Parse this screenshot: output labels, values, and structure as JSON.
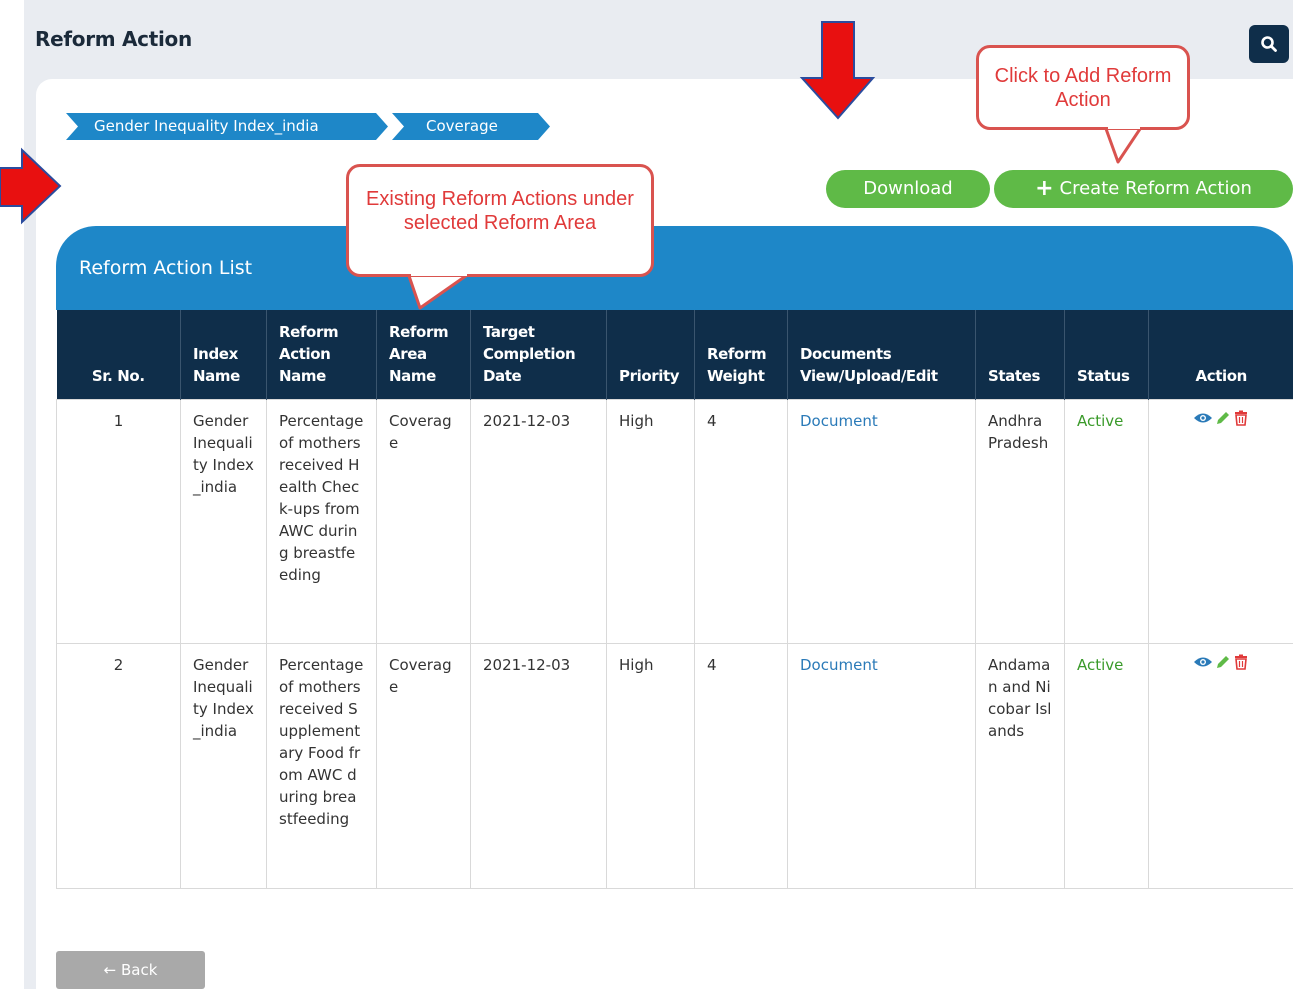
{
  "page": {
    "title": "Reform Action"
  },
  "breadcrumb": [
    {
      "label": "Gender Inequality Index_india"
    },
    {
      "label": "Coverage"
    }
  ],
  "buttons": {
    "download": "Download",
    "create": "Create Reform Action",
    "back": "Back"
  },
  "list": {
    "title": "Reform Action List",
    "columns": [
      "Sr. No.",
      "Index Name",
      "Reform Action Name",
      "Reform Area Name",
      "Target Completion Date",
      "Priority",
      "Reform Weight",
      "Documents View/Upload/Edit",
      "States",
      "Status",
      "Action"
    ],
    "rows": [
      {
        "sr": "1",
        "index_name": "Gender Inequality Index_india",
        "action_name": "Percentage of mothers received Health Check-ups from AWC during breastfeeding",
        "area_name": "Coverage",
        "target_date": "2021-12-03",
        "priority": "High",
        "weight": "4",
        "document": "Document",
        "states": "Andhra Pradesh",
        "status": "Active"
      },
      {
        "sr": "2",
        "index_name": "Gender Inequality Index_india",
        "action_name": "Percentage of mothers received Supplementary Food from AWC during breastfeeding",
        "area_name": "Coverage",
        "target_date": "2021-12-03",
        "priority": "High",
        "weight": "4",
        "document": "Document",
        "states": "Andaman and Nicobar Islands",
        "status": "Active"
      }
    ]
  },
  "annotations": {
    "callout_add": "Click to Add Reform Action",
    "callout_existing": "Existing Reform Actions under selected Reform Area"
  },
  "icons": {
    "search": "search-icon",
    "plus": "plus-icon",
    "back": "arrow-left-icon",
    "view": "eye-icon",
    "edit": "pencil-icon",
    "delete": "trash-icon"
  },
  "colors": {
    "navy": "#0f2e4a",
    "blue": "#1e87c8",
    "green": "#5fba47",
    "annotation_red": "#e03a3a"
  }
}
